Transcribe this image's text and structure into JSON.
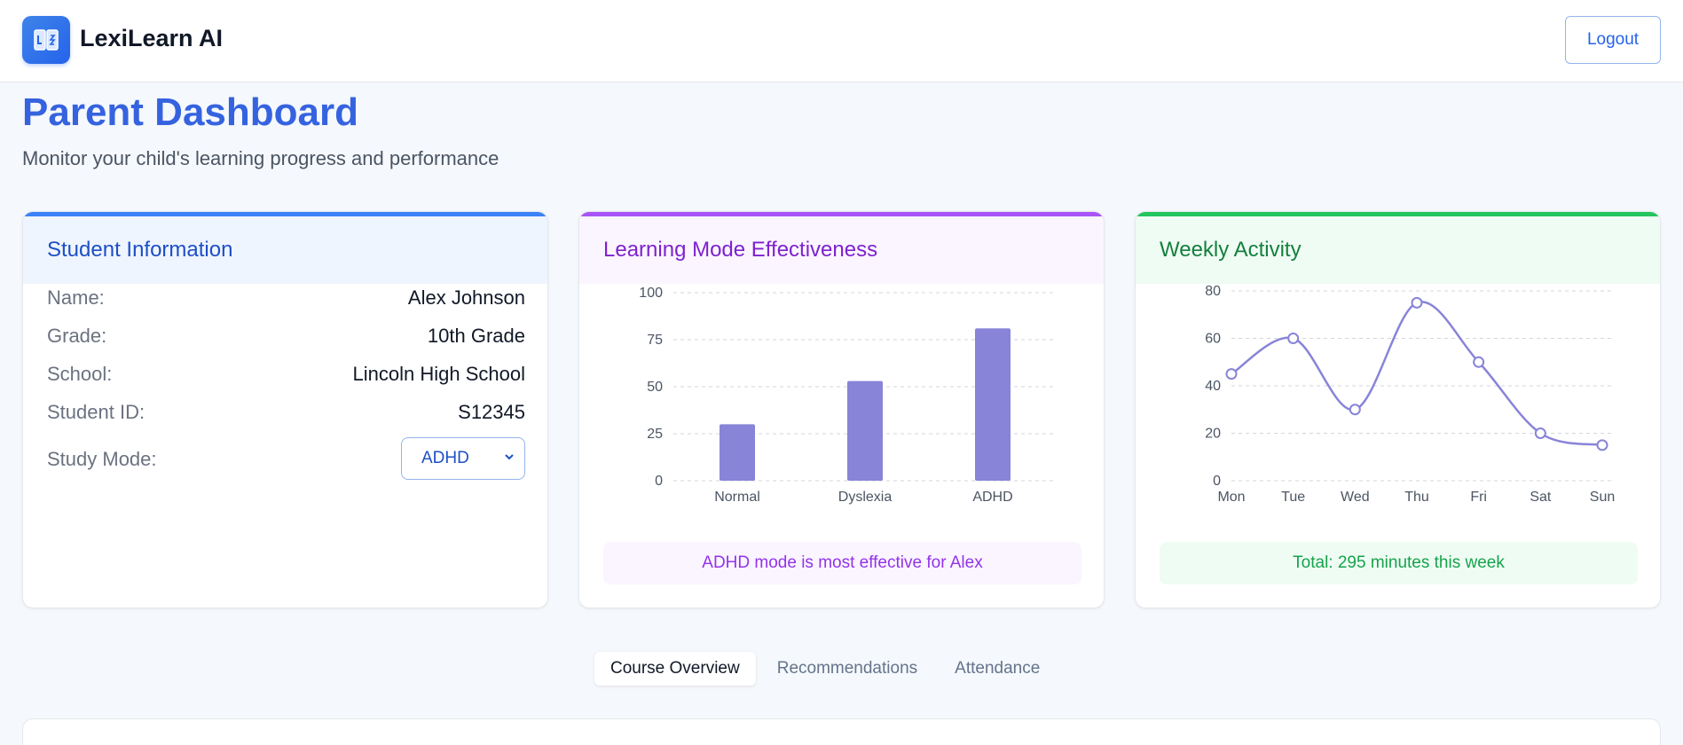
{
  "header": {
    "brand": "LexiLearn AI",
    "logout_label": "Logout"
  },
  "page": {
    "title": "Parent Dashboard",
    "subtitle": "Monitor your child's learning progress and performance"
  },
  "student_card": {
    "title": "Student Information",
    "rows": [
      {
        "label": "Name:",
        "value": "Alex Johnson"
      },
      {
        "label": "Grade:",
        "value": "10th Grade"
      },
      {
        "label": "School:",
        "value": "Lincoln High School"
      },
      {
        "label": "Student ID:",
        "value": "S12345"
      }
    ],
    "study_mode_label": "Study Mode:",
    "study_mode_value": "ADHD"
  },
  "mode_card": {
    "title": "Learning Mode Effectiveness",
    "note": "ADHD mode is most effective for Alex"
  },
  "activity_card": {
    "title": "Weekly Activity",
    "note": "Total: 295 minutes this week"
  },
  "tabs": [
    {
      "label": "Course Overview",
      "active": true
    },
    {
      "label": "Recommendations",
      "active": false
    },
    {
      "label": "Attendance",
      "active": false
    }
  ],
  "colors": {
    "primary": "#3563e0",
    "chart_series": "#8884d8",
    "purple_accent": "#a855f7",
    "green_accent": "#22c55e"
  },
  "icons": {
    "logo": "book-icon",
    "select": "chevron-down-icon"
  },
  "chart_data": [
    {
      "type": "bar",
      "categories": [
        "Normal",
        "Dyslexia",
        "ADHD"
      ],
      "values": [
        30,
        53,
        81
      ],
      "ylim": [
        0,
        100
      ],
      "yticks": [
        0,
        25,
        50,
        75,
        100
      ],
      "grid": true
    },
    {
      "type": "line",
      "x": [
        "Mon",
        "Tue",
        "Wed",
        "Thu",
        "Fri",
        "Sat",
        "Sun"
      ],
      "values": [
        45,
        60,
        30,
        75,
        50,
        20,
        15
      ],
      "ylim": [
        0,
        80
      ],
      "yticks": [
        0,
        20,
        40,
        60,
        80
      ],
      "grid": true
    }
  ]
}
